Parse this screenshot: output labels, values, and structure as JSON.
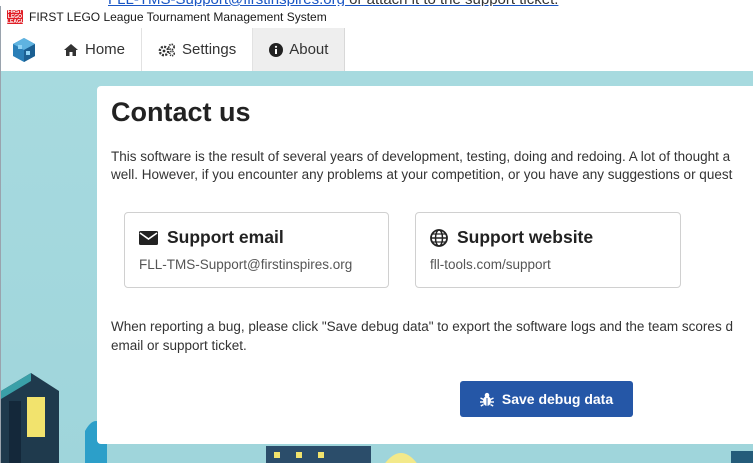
{
  "background_page": {
    "link_text": "FLL-TMS-Support@firstinspires.org",
    "rest_text": " or attach it to the support ticket."
  },
  "window": {
    "logo_lines": [
      "FIRST",
      "LEGO",
      "LEAGUE"
    ],
    "title": "FIRST LEGO League Tournament Management System"
  },
  "nav": {
    "items": [
      {
        "label": "Home",
        "icon": "home-icon"
      },
      {
        "label": "Settings",
        "icon": "cogs-icon"
      },
      {
        "label": "About",
        "icon": "info-circle-icon",
        "active": true
      }
    ]
  },
  "page": {
    "title": "Contact us",
    "intro_line1": "This software is the result of several years of development, testing, doing and redoing. A lot of thought a",
    "intro_line2": "well. However, if you encounter any problems at your competition, or you have any suggestions or quest",
    "support_email": {
      "heading": "Support email",
      "value": "FLL-TMS-Support@firstinspires.org",
      "icon": "envelope-icon"
    },
    "support_website": {
      "heading": "Support website",
      "value": "fll-tools.com/support",
      "icon": "globe-icon"
    },
    "bug_line1": "When reporting a bug, please click \"Save debug data\" to export the software logs and the team scores d",
    "bug_line2": "email or support ticket.",
    "save_button": {
      "label": "Save debug data",
      "icon": "bug-icon"
    }
  },
  "colors": {
    "primary_button": "#2557a7",
    "background": "#a9dcdf",
    "link": "#1a56c4"
  }
}
